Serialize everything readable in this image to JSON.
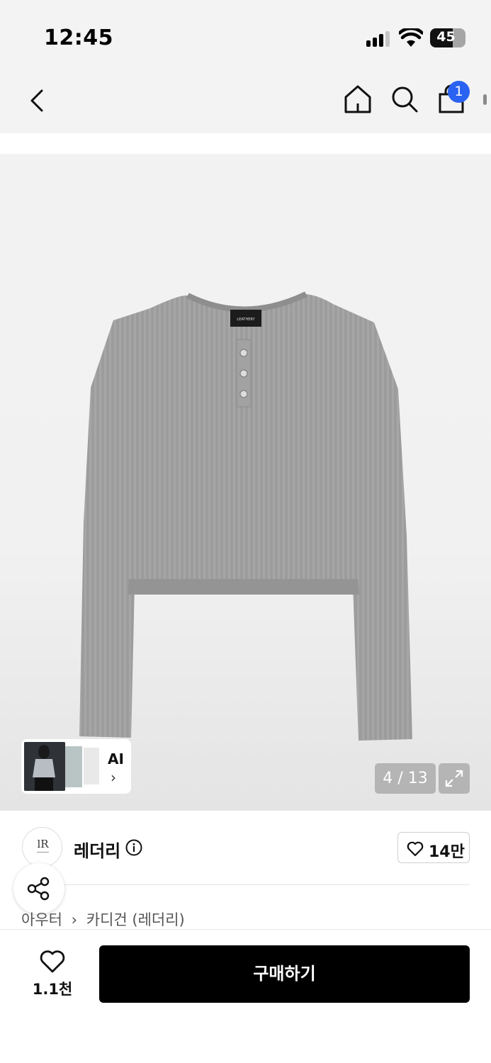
{
  "status_bar": {
    "time": "12:45",
    "battery_percent": "45",
    "signal_bars": 3,
    "icons": [
      "cellular-signal-icon",
      "wifi-icon",
      "battery-icon"
    ]
  },
  "nav": {
    "icons": [
      "back-icon",
      "home-icon",
      "search-icon",
      "shopping-bag-icon"
    ],
    "cart_badge": "1",
    "badge_color": "#2a63f1"
  },
  "gallery": {
    "image_label": "LEATHERY",
    "ai_label": "AI",
    "ai_arrow": "›",
    "counter": "4 / 13",
    "current_image": 4,
    "total_images": 13,
    "icons": [
      "expand-icon"
    ]
  },
  "brand": {
    "monogram": "lR",
    "name": "레더리",
    "likes": "14만",
    "icons": [
      "info-icon",
      "heart-icon",
      "share-icon"
    ]
  },
  "breadcrumb": {
    "items": [
      "아우터",
      "카디건 (레더리)"
    ],
    "separator": "›"
  },
  "bottom_bar": {
    "wish_count": "1.1천",
    "buy_label": "구매하기",
    "icons": [
      "heart-outline-icon"
    ]
  }
}
